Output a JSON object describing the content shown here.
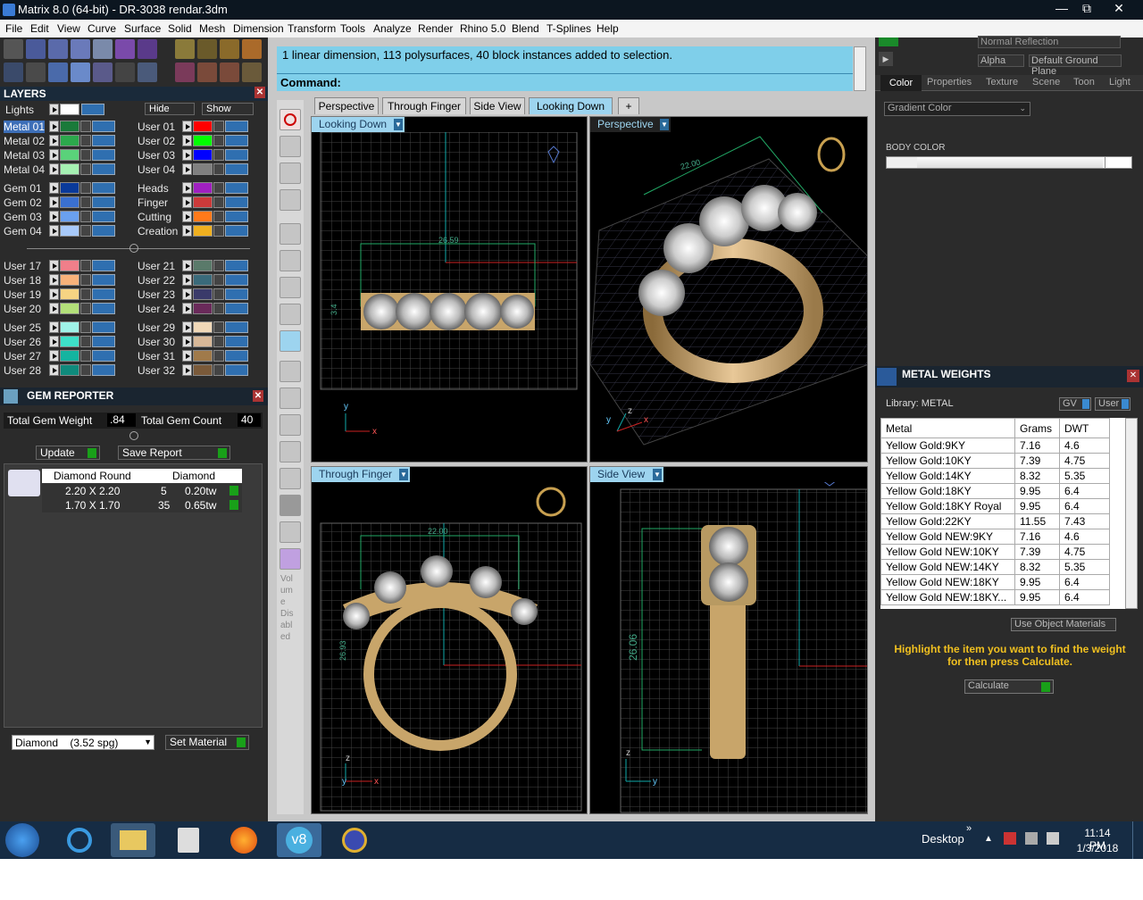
{
  "window": {
    "title": "Matrix 8.0 (64-bit) - DR-3038 rendar.3dm",
    "min": "—",
    "max": "⧉",
    "close": "✕"
  },
  "menu": [
    "File",
    "Edit",
    "View",
    "Curve",
    "Surface",
    "Solid",
    "Mesh",
    "Dimension",
    "Transform",
    "Tools",
    "Analyze",
    "Render",
    "Rhino 5.0",
    "Blend",
    "T-Splines",
    "Help"
  ],
  "layers": {
    "title": "LAYERS",
    "lights": "Lights",
    "hide": "Hide",
    "show": "Show",
    "left": [
      {
        "n": "Metal 01",
        "c": "#1a7a3a"
      },
      {
        "n": "Metal 02",
        "c": "#2ca84c"
      },
      {
        "n": "Metal 03",
        "c": "#5ad27a"
      },
      {
        "n": "Metal 04",
        "c": "#a5f0b2"
      },
      {
        "n": "Gem 01",
        "c": "#0a3a9a"
      },
      {
        "n": "Gem 02",
        "c": "#3a70d0"
      },
      {
        "n": "Gem 03",
        "c": "#6aa0ee"
      },
      {
        "n": "Gem 04",
        "c": "#a8cafa"
      },
      {
        "n": "User 17",
        "c": "#f07f8a"
      },
      {
        "n": "User 18",
        "c": "#f7b27a"
      },
      {
        "n": "User 19",
        "c": "#f6d483"
      },
      {
        "n": "User 20",
        "c": "#b3e07a"
      },
      {
        "n": "User 25",
        "c": "#9ff2e8"
      },
      {
        "n": "User 26",
        "c": "#3ee0c9"
      },
      {
        "n": "User 27",
        "c": "#14b4a0"
      },
      {
        "n": "User 28",
        "c": "#0f8a7c"
      }
    ],
    "right": [
      {
        "n": "User 01",
        "c": "#ff0000"
      },
      {
        "n": "User 02",
        "c": "#00ff00"
      },
      {
        "n": "User 03",
        "c": "#0000ff"
      },
      {
        "n": "User 04",
        "c": "#808080"
      },
      {
        "n": "Heads",
        "c": "#a020c0"
      },
      {
        "n": "Finger",
        "c": "#cc3a3a"
      },
      {
        "n": "Cutting",
        "c": "#ff7a1a"
      },
      {
        "n": "Creation",
        "c": "#f0b020"
      },
      {
        "n": "User 21",
        "c": "#5a7a6a"
      },
      {
        "n": "User 22",
        "c": "#3a6a7a"
      },
      {
        "n": "User 23",
        "c": "#3a3a6a"
      },
      {
        "n": "User 24",
        "c": "#6a2a5a"
      },
      {
        "n": "User 29",
        "c": "#f0d8b8"
      },
      {
        "n": "User 30",
        "c": "#d8b898"
      },
      {
        "n": "User 31",
        "c": "#a07a4a"
      },
      {
        "n": "User 32",
        "c": "#7a5a3a"
      }
    ]
  },
  "gem": {
    "title": "GEM REPORTER",
    "total_weight_label": "Total Gem Weight",
    "total_weight": ".84",
    "total_count_label": "Total Gem Count",
    "total_count": "40",
    "update": "Update",
    "save": "Save Report",
    "head1": "Diamond Round",
    "head2": "Diamond",
    "rows": [
      {
        "size": "2.20 X 2.20",
        "qty": "5",
        "tw": "0.20tw"
      },
      {
        "size": "1.70 X 1.70",
        "qty": "35",
        "tw": "0.65tw"
      }
    ],
    "material": "Diamond    (3.52 spg)",
    "set_material": "Set Material"
  },
  "command": {
    "message": "1 linear dimension, 113 polysurfaces, 40 block instances added to selection.",
    "label": "Command:"
  },
  "tabs": [
    "Perspective",
    "Through Finger",
    "Side View",
    "Looking Down"
  ],
  "viewports": {
    "looking_down": {
      "label": "Looking Down",
      "dim1": "26.59",
      "dim2": "3.4",
      "ax_y": "y",
      "ax_x": "x"
    },
    "perspective": {
      "label": "Perspective",
      "dim": "22.00",
      "ax_z": "z",
      "ax_y": "y",
      "ax_x": "x"
    },
    "through_finger": {
      "label": "Through Finger",
      "dim1": "22.00",
      "dim2": "26.93",
      "ax_z": "z",
      "ax_y": "y",
      "ax_x": "x"
    },
    "side_view": {
      "label": "Side View",
      "dim": "26.06",
      "ax_z": "z",
      "ax_y": "y"
    }
  },
  "volume": [
    "Vol",
    "um",
    "e",
    "Dis",
    "abl",
    "ed"
  ],
  "right": {
    "reflection": "Normal Reflection",
    "alpha": "Alpha",
    "ground": "Default Ground Plane",
    "tabs": [
      "Color",
      "Properties",
      "Texture",
      "Scene",
      "Toon",
      "Light"
    ],
    "gradient": "Gradient Color",
    "body_color": "BODY COLOR"
  },
  "metal": {
    "title": "METAL WEIGHTS",
    "library": "Library: METAL",
    "gv": "GV",
    "user": "User",
    "cols": [
      "Metal",
      "Grams",
      "DWT"
    ],
    "rows": [
      [
        "Yellow Gold:9KY",
        "7.16",
        "4.6"
      ],
      [
        "Yellow Gold:10KY",
        "7.39",
        "4.75"
      ],
      [
        "Yellow Gold:14KY",
        "8.32",
        "5.35"
      ],
      [
        "Yellow Gold:18KY",
        "9.95",
        "6.4"
      ],
      [
        "Yellow Gold:18KY Royal",
        "9.95",
        "6.4"
      ],
      [
        "Yellow Gold:22KY",
        "11.55",
        "7.43"
      ],
      [
        "Yellow Gold NEW:9KY",
        "7.16",
        "4.6"
      ],
      [
        "Yellow Gold NEW:10KY",
        "7.39",
        "4.75"
      ],
      [
        "Yellow Gold NEW:14KY",
        "8.32",
        "5.35"
      ],
      [
        "Yellow Gold NEW:18KY",
        "9.95",
        "6.4"
      ],
      [
        "Yellow Gold NEW:18KY...",
        "9.95",
        "6.4"
      ]
    ],
    "use_obj": "Use Object Materials",
    "hint": "Highlight the item you want to find the weight for then press Calculate.",
    "calculate": "Calculate"
  },
  "taskbar": {
    "desktop": "Desktop",
    "time": "11:14 PM",
    "date": "1/3/2018"
  }
}
